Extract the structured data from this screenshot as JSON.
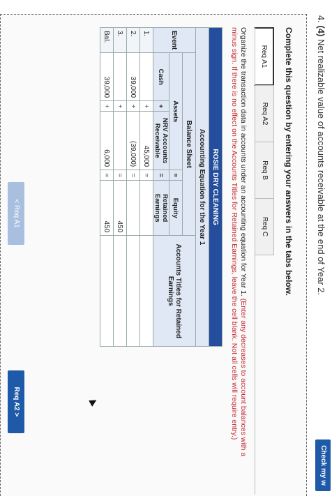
{
  "question": {
    "number": "4.",
    "points": "(4)",
    "text": "Net realizable value of accounts receivable at the end of Year 2."
  },
  "check_button": "Check my w",
  "instructions": "Complete this question by entering your answers in the tabs below.",
  "tabs": [
    {
      "label": "Req A1",
      "active": true
    },
    {
      "label": "Req A2",
      "active": false
    },
    {
      "label": "Req B",
      "active": false
    },
    {
      "label": "Req C",
      "active": false
    }
  ],
  "description": {
    "main": "Organize the transaction data in accounts under an accounting equation for Year 1.",
    "note": "(Enter any decreases to account balances with a minus sign. If there is no effect on the Accounts Titles for Retained Earnings, leave the cell blank. Not all cells will require entry.)"
  },
  "sheet": {
    "company": "ROSIE DRY CLEANING",
    "title": "Accounting Equation for the Year 1",
    "subtitle": "Balance Sheet",
    "event_header": "Event",
    "assets_header": "Assets",
    "equity_header": "Equity",
    "titles_header": "Accounts Titles for Retained Earnings",
    "col_cash": "Cash",
    "col_nrv": "NRV Accounts Receivable",
    "col_re": "Retained Earnings",
    "plus": "+",
    "equals": "=",
    "rows": [
      {
        "event": "1.",
        "cash": "",
        "nrv": "45,000",
        "re": "",
        "title": ""
      },
      {
        "event": "2.",
        "cash": "39,000",
        "nrv": "(39,000)",
        "re": "",
        "title": ""
      },
      {
        "event": "3.",
        "cash": "",
        "nrv": "",
        "re": "450",
        "title": ""
      },
      {
        "event": "Bal.",
        "cash": "39,000",
        "nrv": "6,000",
        "re": "450",
        "title": ""
      }
    ]
  },
  "nav": {
    "prev_label": "< Req A1",
    "next_label": "Req A2 >"
  },
  "colors": {
    "header_blue": "#244e9c",
    "button_blue": "#1e5aa8",
    "light_blue": "#dfe8f4",
    "note_red": "#c1272d"
  }
}
